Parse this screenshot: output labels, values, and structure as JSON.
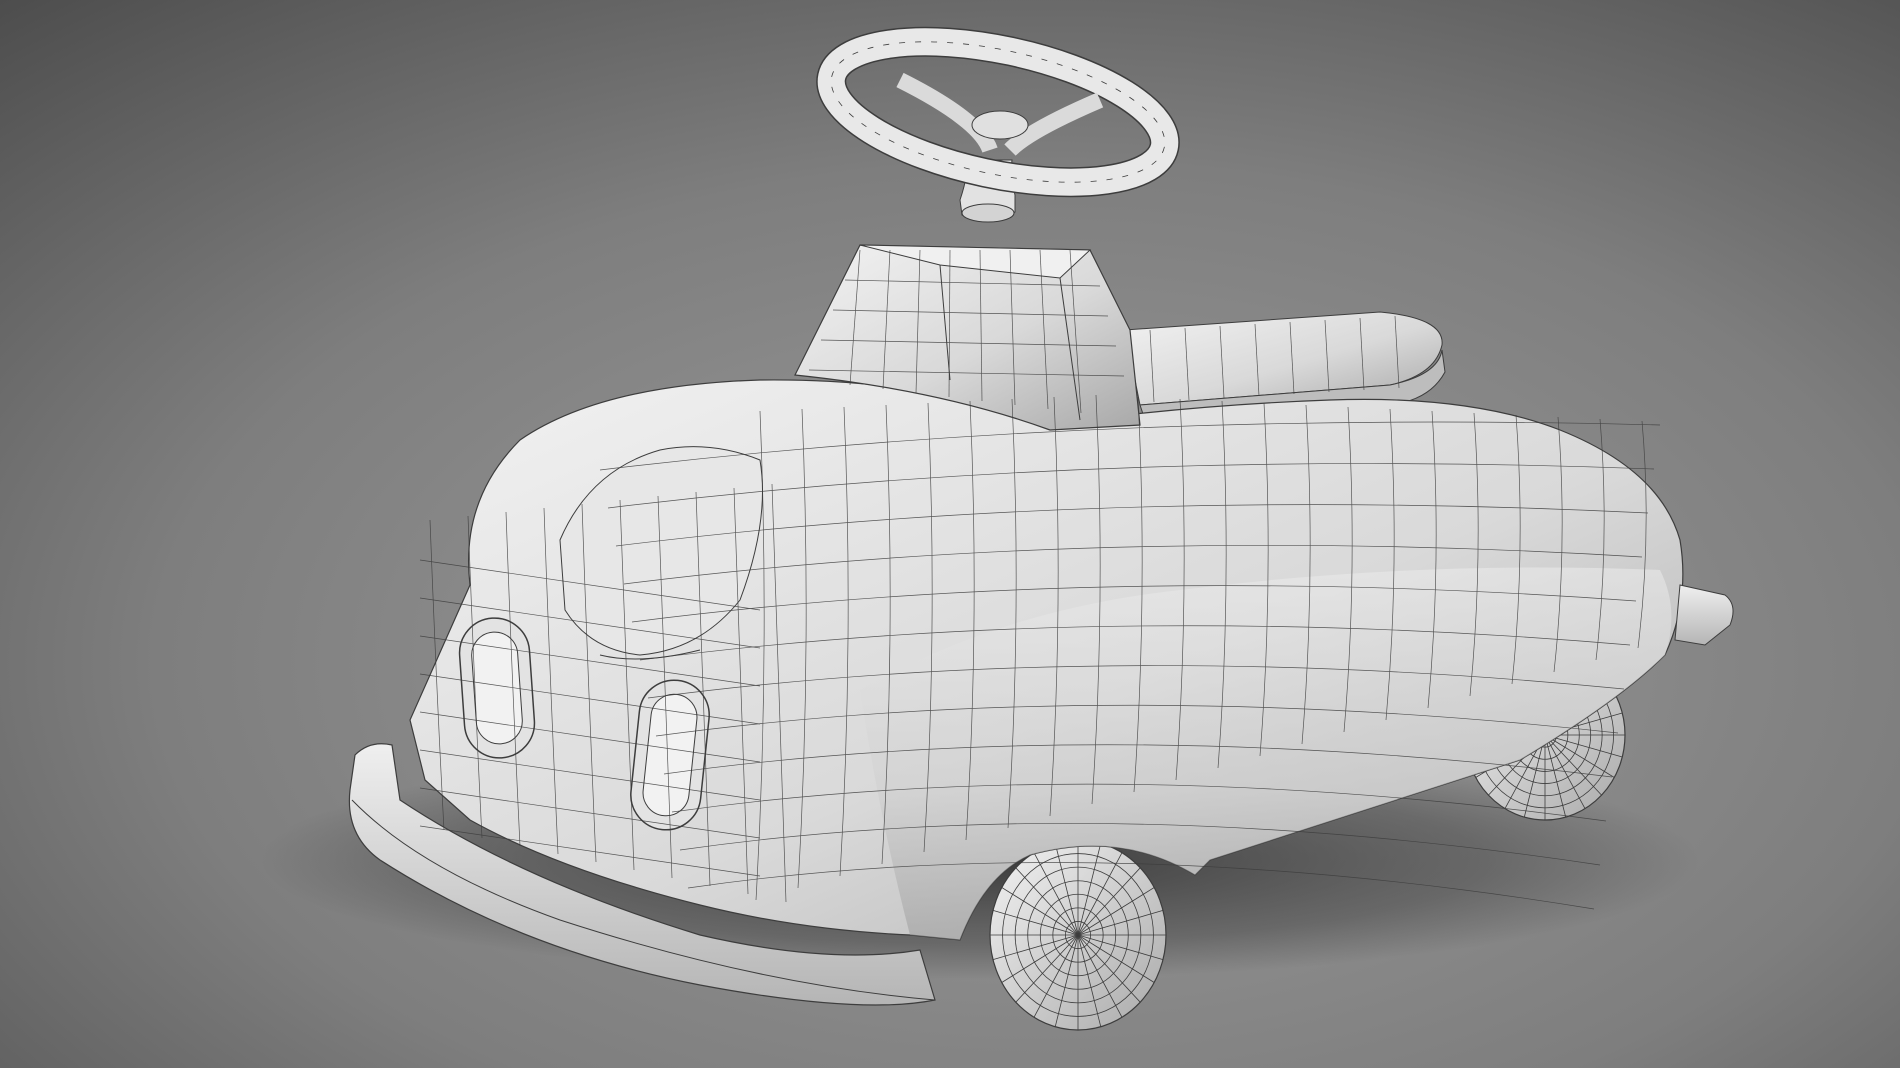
{
  "scene": {
    "subject": "toy-pedal-car-wireframe-render",
    "colors": {
      "backdrop_light": "#9a9a9a",
      "backdrop_mid": "#7e7e7e",
      "backdrop_dark": "#4e4e4e",
      "clay_light": "#f4f4f4",
      "clay_mid": "#d6d6d6",
      "clay_dark": "#a2a2a2",
      "wire": "#3d3d3d",
      "shadow": "#2c2c2c"
    }
  }
}
